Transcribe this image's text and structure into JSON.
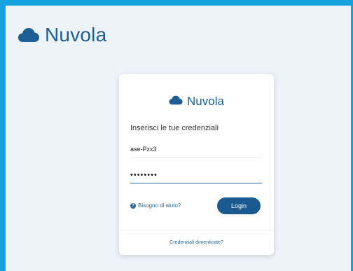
{
  "header": {
    "brand_name": "Nuvola",
    "logo_icon": "cloud-icon",
    "brand_color": "#1d5f93"
  },
  "login_card": {
    "brand_name": "Nuvola",
    "heading": "Inserisci le tue credenziali",
    "username_value": "ase-Pzx3",
    "password_value": "••••••••",
    "help_link": "Bisogno di aiuto?",
    "help_icon": "question-circle-icon",
    "login_button": "Login",
    "forgot_link": "Credenziali dimenticate?"
  },
  "colors": {
    "frame_border": "#15a3df",
    "background": "#eef3f8",
    "button": "#1b5a8f"
  }
}
